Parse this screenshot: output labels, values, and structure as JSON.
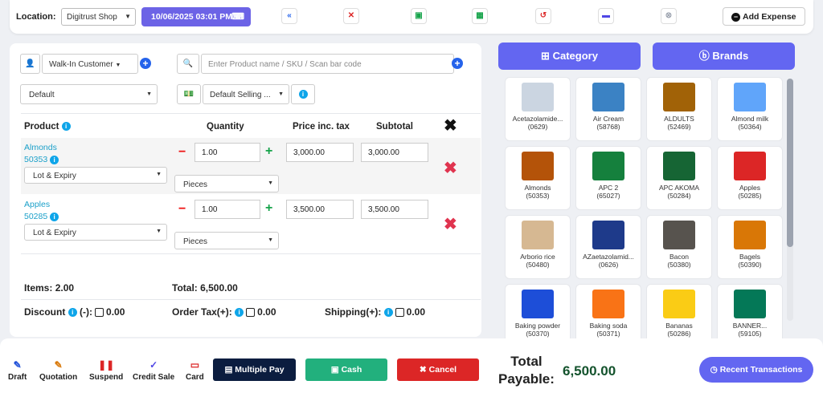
{
  "header": {
    "location_label": "Location:",
    "location_value": "Digitrust Shop",
    "datetime": "10/06/2025 03:01 PM",
    "add_expense": "Add Expense",
    "icons": [
      "rewind-icon",
      "cancel-icon",
      "briefcase-icon",
      "calculator-icon",
      "undo-icon",
      "window-icon",
      "close-circle-icon"
    ]
  },
  "customer": {
    "value": "Walk-In Customer"
  },
  "search": {
    "placeholder": "Enter Product name / SKU / Scan bar code"
  },
  "price_group": {
    "value": "Default"
  },
  "selling_price": {
    "value": "Default Selling ..."
  },
  "table": {
    "headers": {
      "product": "Product",
      "quantity": "Quantity",
      "price": "Price inc. tax",
      "subtotal": "Subtotal"
    },
    "rows": [
      {
        "name": "Almonds",
        "sku": "50353",
        "lot": "Lot & Expiry",
        "qty": "1.00",
        "unit": "Pieces",
        "price": "3,000.00",
        "subtotal": "3,000.00"
      },
      {
        "name": "Apples",
        "sku": "50285",
        "lot": "Lot & Expiry",
        "qty": "1.00",
        "unit": "Pieces",
        "price": "3,500.00",
        "subtotal": "3,500.00"
      }
    ]
  },
  "totals": {
    "items_label": "Items:",
    "items_value": "2.00",
    "total_label": "Total:",
    "total_value": "6,500.00",
    "discount_label": "Discount",
    "discount_suffix": "(-):",
    "discount_value": "0.00",
    "tax_label": "Order Tax(+):",
    "tax_value": "0.00",
    "shipping_label": "Shipping(+):",
    "shipping_value": "0.00"
  },
  "tabs": {
    "category": "Category",
    "brands": "Brands"
  },
  "products": [
    {
      "name": "Acetazolamide...",
      "code": "(0629)",
      "color": "#cbd5e1"
    },
    {
      "name": "Air Cream",
      "code": "(58768)",
      "color": "#3b82c4"
    },
    {
      "name": "ALDULTS",
      "code": "(52469)",
      "color": "#a16207"
    },
    {
      "name": "Almond milk",
      "code": "(50364)",
      "color": "#60a5fa"
    },
    {
      "name": "Almonds",
      "code": "(50353)",
      "color": "#b45309"
    },
    {
      "name": "APC 2",
      "code": "(65027)",
      "color": "#15803d"
    },
    {
      "name": "APC AKOMA",
      "code": "(50284)",
      "color": "#166534"
    },
    {
      "name": "Apples",
      "code": "(50285)",
      "color": "#dc2626"
    },
    {
      "name": "Arborio rice",
      "code": "(50480)",
      "color": "#d6b892"
    },
    {
      "name": "AZaetazolamid...",
      "code": "(0626)",
      "color": "#1e3a8a"
    },
    {
      "name": "Bacon",
      "code": "(50380)",
      "color": "#57534e"
    },
    {
      "name": "Bagels",
      "code": "(50390)",
      "color": "#d97706"
    },
    {
      "name": "Baking powder",
      "code": "(50370)",
      "color": "#1d4ed8"
    },
    {
      "name": "Baking soda",
      "code": "(50371)",
      "color": "#f97316"
    },
    {
      "name": "Bananas",
      "code": "(50286)",
      "color": "#facc15"
    },
    {
      "name": "BANNER...",
      "code": "(59105)",
      "color": "#047857"
    }
  ],
  "bottom": {
    "draft": "Draft",
    "quotation": "Quotation",
    "suspend": "Suspend",
    "credit_sale": "Credit Sale",
    "card": "Card",
    "multiple_pay": "Multiple Pay",
    "cash": "Cash",
    "cancel": "Cancel",
    "total_payable_1": "Total",
    "total_payable_2": "Payable:",
    "total_payable_value": "6,500.00",
    "recent": "Recent Transactions"
  }
}
